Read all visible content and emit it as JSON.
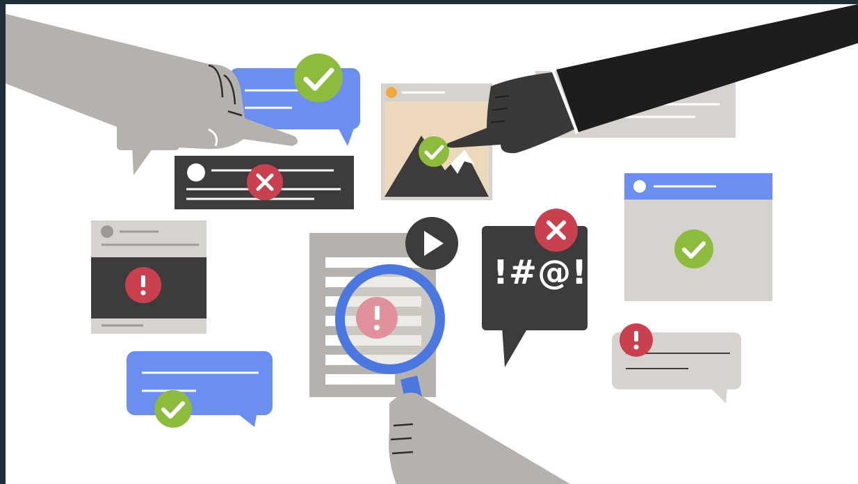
{
  "illustration": {
    "profanity_symbols": "!#@!",
    "colors": {
      "background": "#ffffff",
      "frame": "#1f2f3a",
      "blue": "#6a8ff0",
      "green": "#8dbb3b",
      "red": "#c9404f",
      "dark": "#3d3b3b",
      "gray": "#d6d3ce",
      "hand_gray": "#b5b1ac",
      "hand_dark": "#3b3838",
      "sleeve": "#1d1d1d"
    },
    "icons": [
      "check-badge-icon",
      "x-badge-icon",
      "alert-badge-icon",
      "play-icon",
      "magnifying-glass-icon",
      "mountain-image-icon"
    ]
  }
}
